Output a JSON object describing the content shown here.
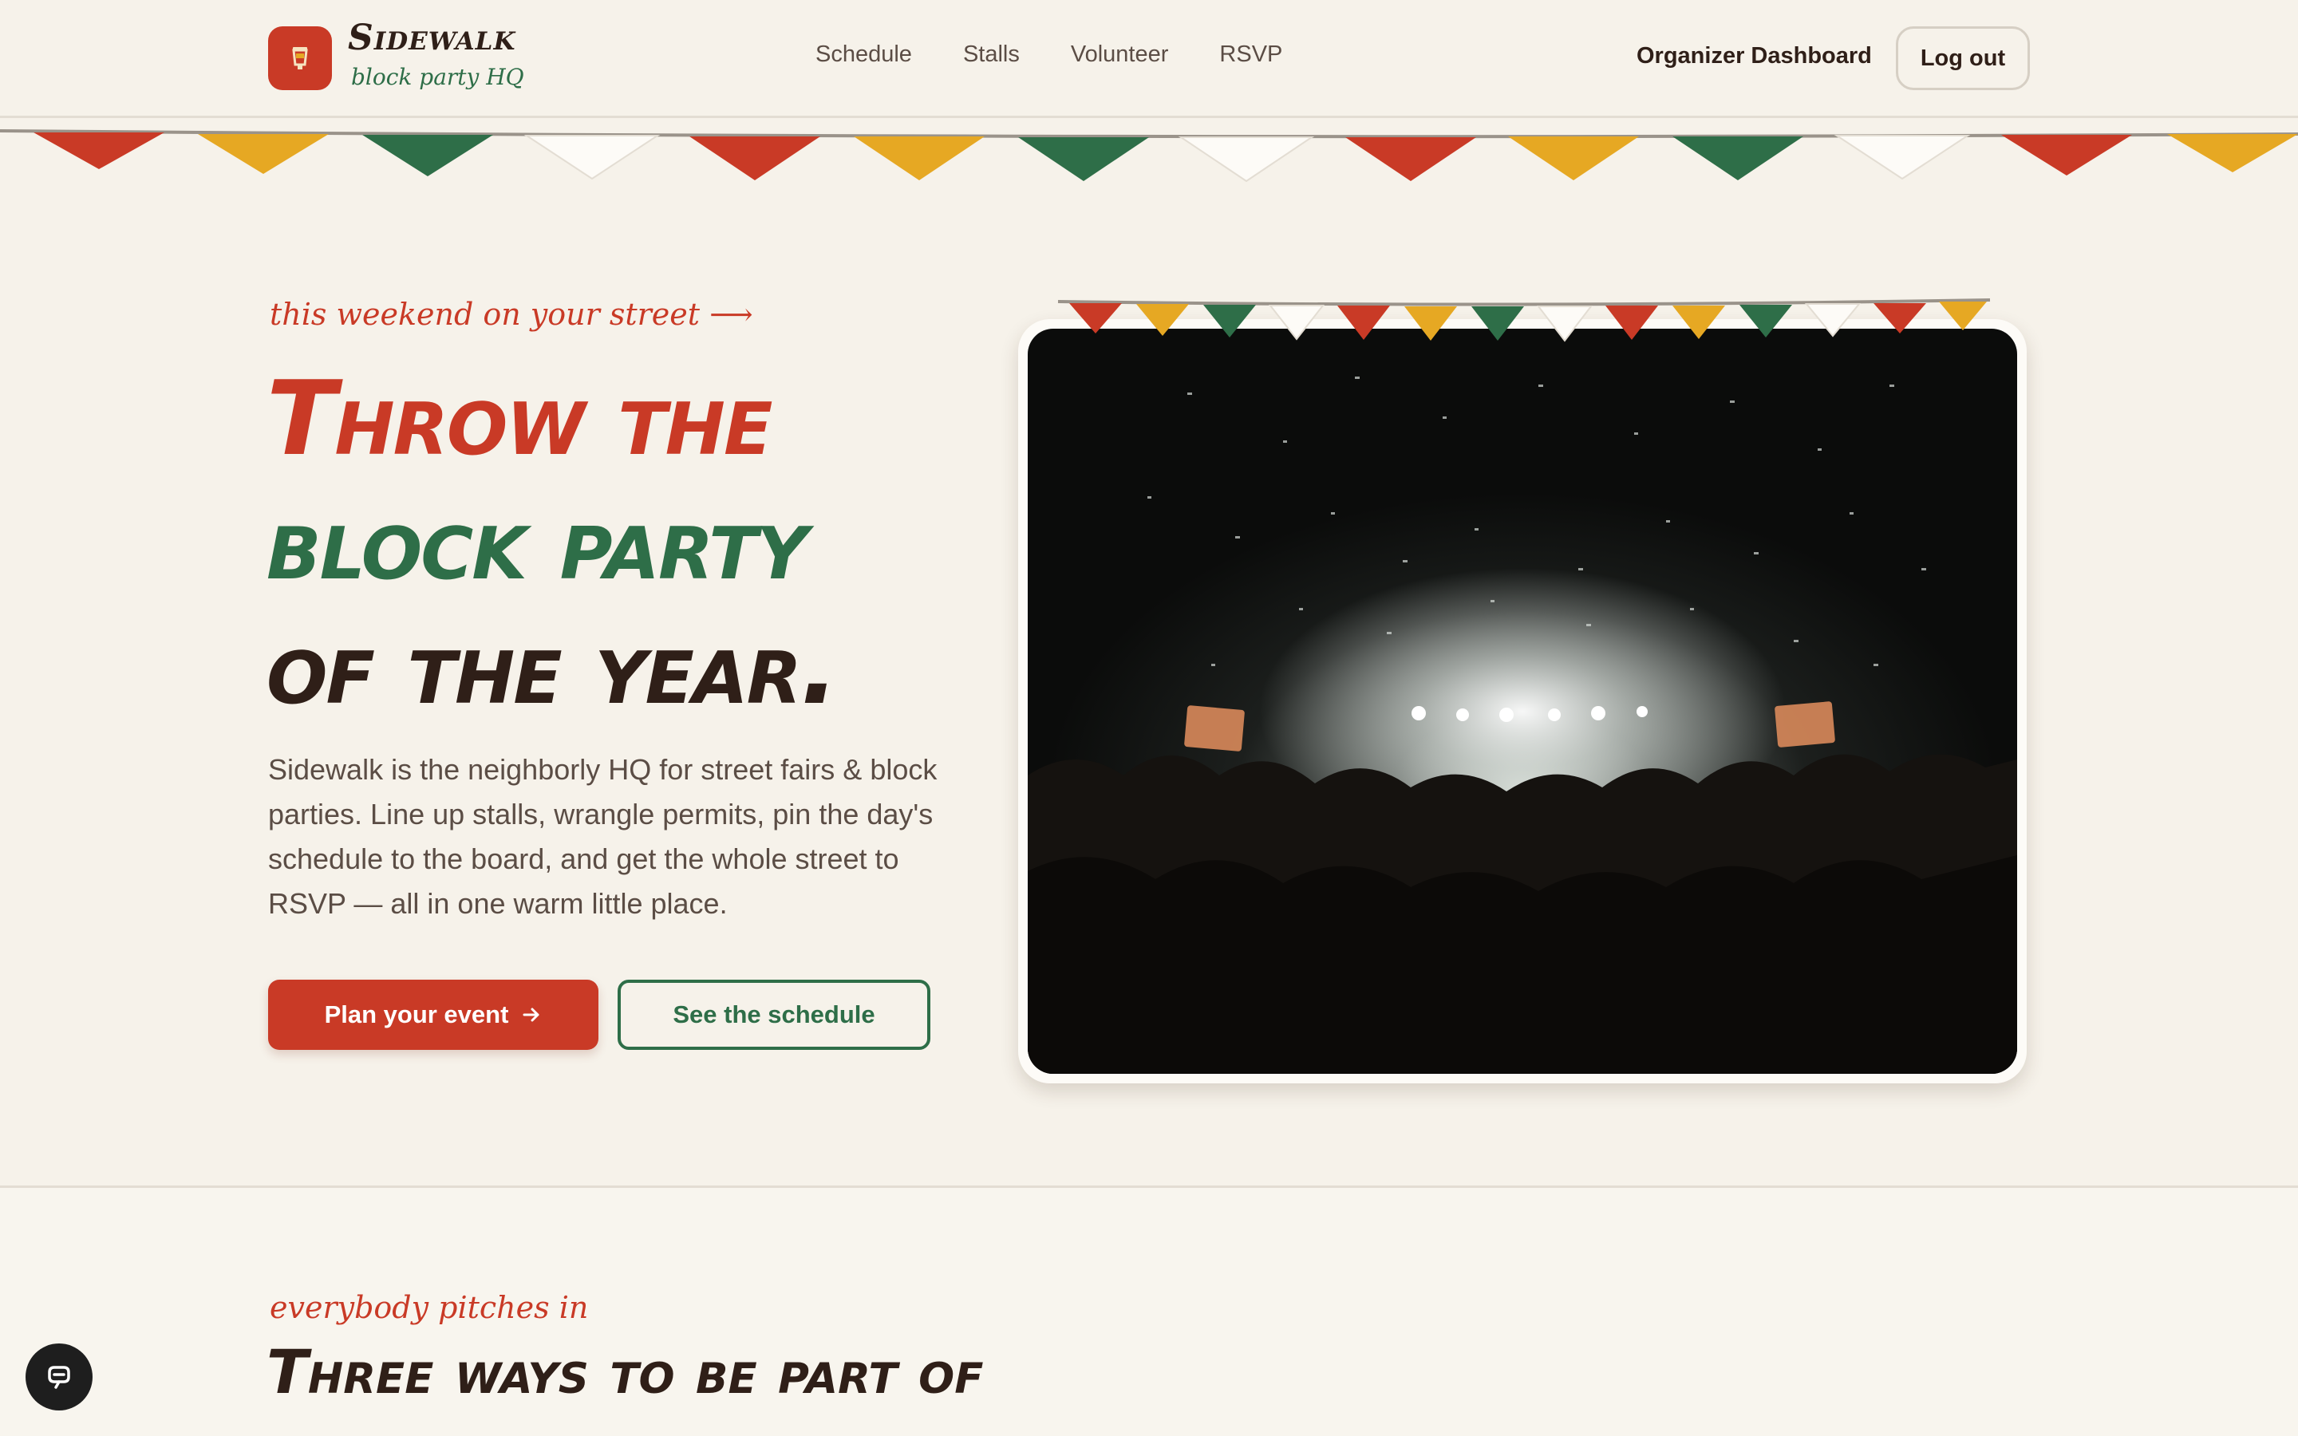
{
  "brand": {
    "name": "Sidewalk",
    "tagline": "block party HQ"
  },
  "nav": {
    "links": [
      "Schedule",
      "Stalls",
      "Volunteer",
      "RSVP"
    ],
    "dashboard": "Organizer Dashboard",
    "logout": "Log out"
  },
  "hero": {
    "eyebrow": "this weekend on your street ⟶",
    "headline_1": "Throw the",
    "headline_2": "block party",
    "headline_3": "of the year.",
    "lede": "Sidewalk is the neighborly HQ for street fairs & block parties. Line up stalls, wrangle permits, pin the day's schedule to the board, and get the whole street to RSVP — all in one warm little place.",
    "primary_cta": "Plan your event",
    "secondary_cta": "See the schedule"
  },
  "section2": {
    "eyebrow": "everybody pitches in",
    "heading": "Three ways to be part of the fair"
  },
  "colors": {
    "red": "#c93a26",
    "green": "#2e6e48",
    "mustard": "#e6a823",
    "cream": "#f6f2ea",
    "dark": "#2f1f18"
  },
  "icons": {
    "logo": "lantern-icon",
    "arrow": "arrow-right-icon",
    "chat": "chat-icon"
  }
}
